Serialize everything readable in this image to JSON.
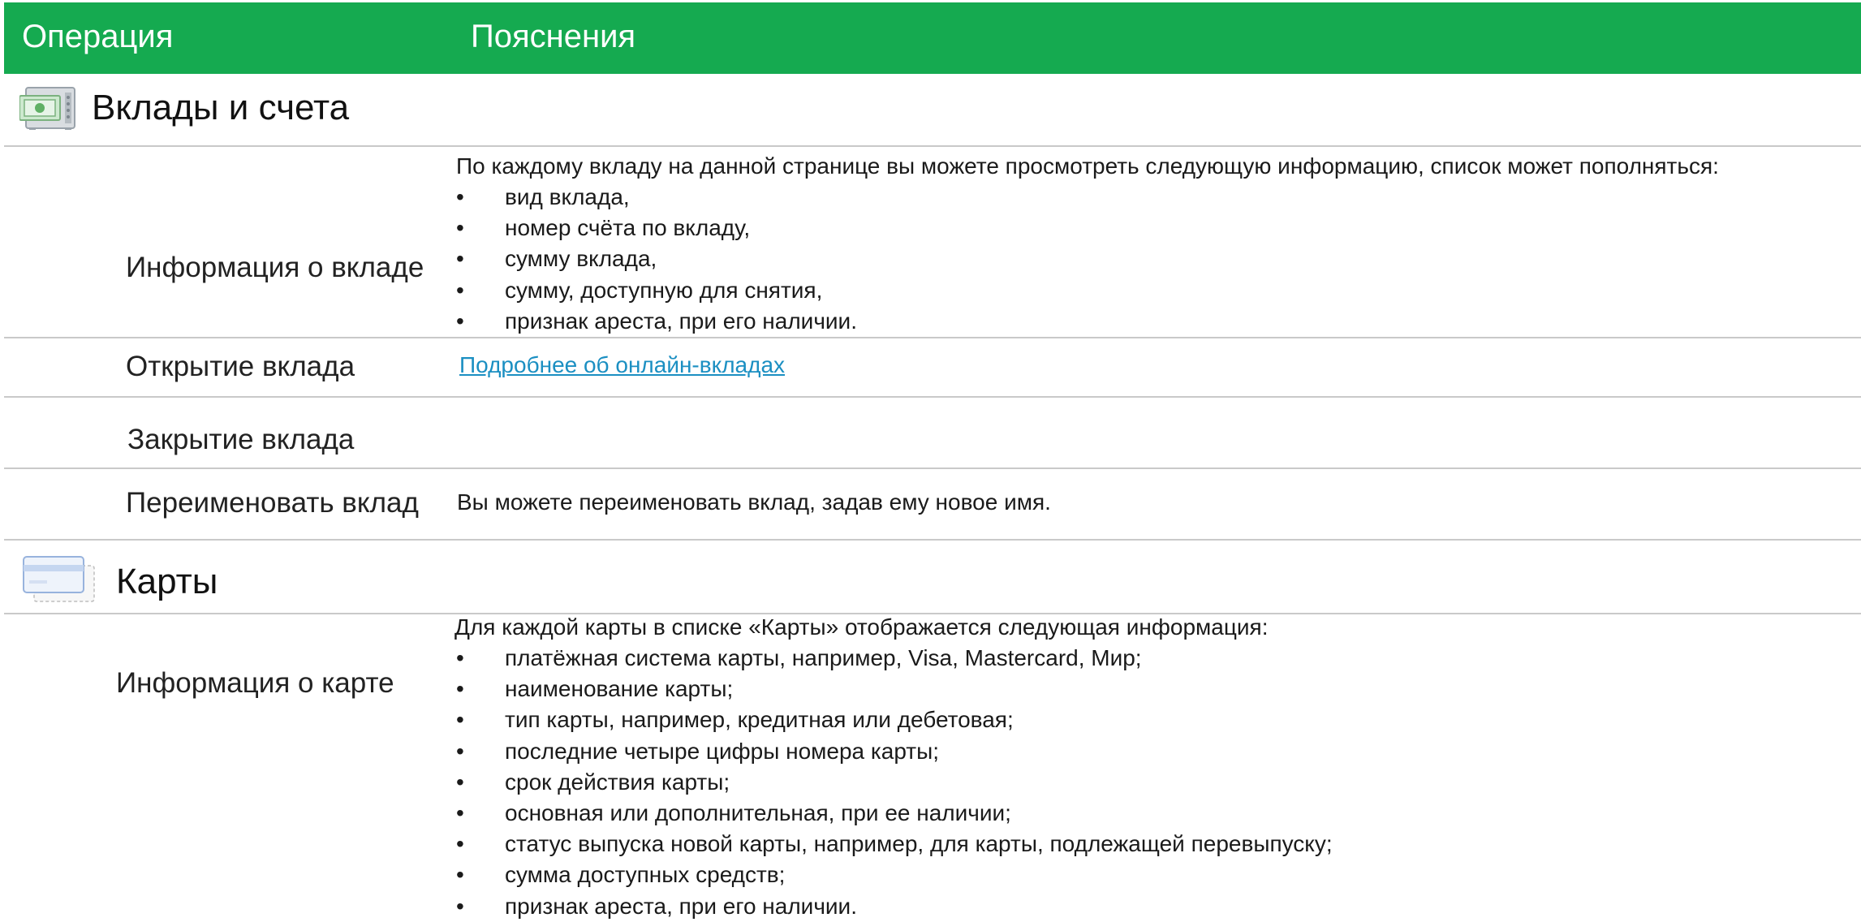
{
  "header": {
    "col_operation": "Операция",
    "col_notes": "Пояснения",
    "bg_color": "#15aa50"
  },
  "sections": [
    {
      "icon": "safe-icon",
      "title": "Вклады и счета",
      "rows": [
        {
          "operation": "Информация о вкладе",
          "intro": "По каждому вкладу на данной странице вы можете просмотреть следующую информацию, список может пополняться:",
          "items": [
            "вид вклада,",
            "номер счёта по вкладу,",
            "сумму вклада,",
            "сумму, доступную для снятия,",
            "признак ареста, при его наличии."
          ]
        },
        {
          "operation": "Открытие вклада",
          "link": "Подробнее об онлайн-вкладах"
        },
        {
          "operation": "Закрытие вклада",
          "text": ""
        },
        {
          "operation": "Переименовать вклад",
          "text": "Вы можете переименовать вклад, задав ему новое имя."
        }
      ]
    },
    {
      "icon": "card-icon",
      "title": "Карты",
      "rows": [
        {
          "operation": "Информация о карте",
          "intro": "Для каждой карты в списке «Карты» отображается следующая информация:",
          "items": [
            "платёжная система карты, например, Visa, Mastercard, Мир;",
            "наименование карты;",
            "тип карты, например, кредитная или дебетовая;",
            "последние четыре цифры номера карты;",
            "срок действия карты;",
            "основная или дополнительная, при ее наличии;",
            "статус выпуска новой карты, например, для карты, подлежащей перевыпуску;",
            "сумма доступных средств;",
            "признак ареста, при его наличии."
          ]
        }
      ]
    }
  ],
  "bullet": "•",
  "link_color": "#1b8fc2"
}
